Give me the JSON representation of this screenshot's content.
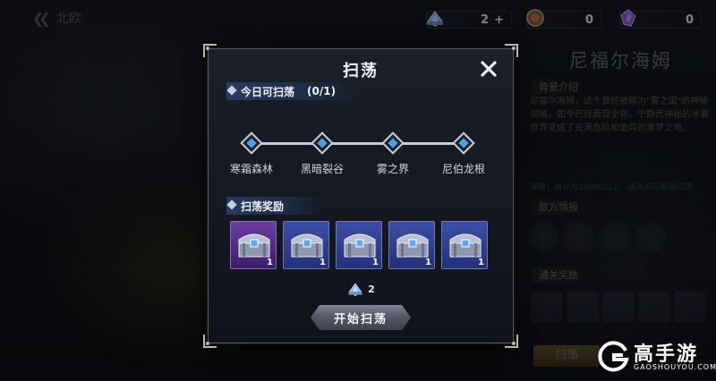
{
  "nav": {
    "back_label": "北欧"
  },
  "resources": [
    {
      "icon": "blue-crystal-icon",
      "value": "2",
      "plus": "+"
    },
    {
      "icon": "bronze-coin-icon",
      "value": "0"
    },
    {
      "icon": "purple-gem-icon",
      "value": "0"
    }
  ],
  "right_panel": {
    "title": "尼福尔海姆",
    "bg_section": "背景介绍",
    "description": "尼福尔海姆，这个曾经被称为\"雾之国\"的神秘领域，如今已经面目全非。宁静而神秘的冰雾世界变成了充满危险和诡异的噩梦之地。",
    "green_note": "推荐：战斗力10000以上，通关后可解锁扫荡",
    "enemy_section": "敌方情报",
    "reward_section": "通关奖励",
    "sweep_button": "扫荡"
  },
  "dialog": {
    "title": "扫荡",
    "today_label": "今日可扫荡",
    "today_count": "(0/1)",
    "stages": [
      "寒霜森林",
      "黑暗裂谷",
      "雾之界",
      "尼伯龙根"
    ],
    "reward_label": "扫荡奖励",
    "rewards": [
      {
        "rarity": "purple",
        "qty": "1"
      },
      {
        "rarity": "blue",
        "qty": "1"
      },
      {
        "rarity": "blue",
        "qty": "1"
      },
      {
        "rarity": "blue",
        "qty": "1"
      },
      {
        "rarity": "blue",
        "qty": "1"
      }
    ],
    "cost_value": "2",
    "start_button": "开始扫荡"
  },
  "watermark": {
    "brand": "高手游",
    "url": "GAOSHOUYOU.COM"
  },
  "colors": {
    "accent_blue": "#283a5e",
    "panel_gold": "#d2b86a",
    "chest_blue": "#3d4fa6",
    "chest_purple": "#6a3fa0"
  }
}
